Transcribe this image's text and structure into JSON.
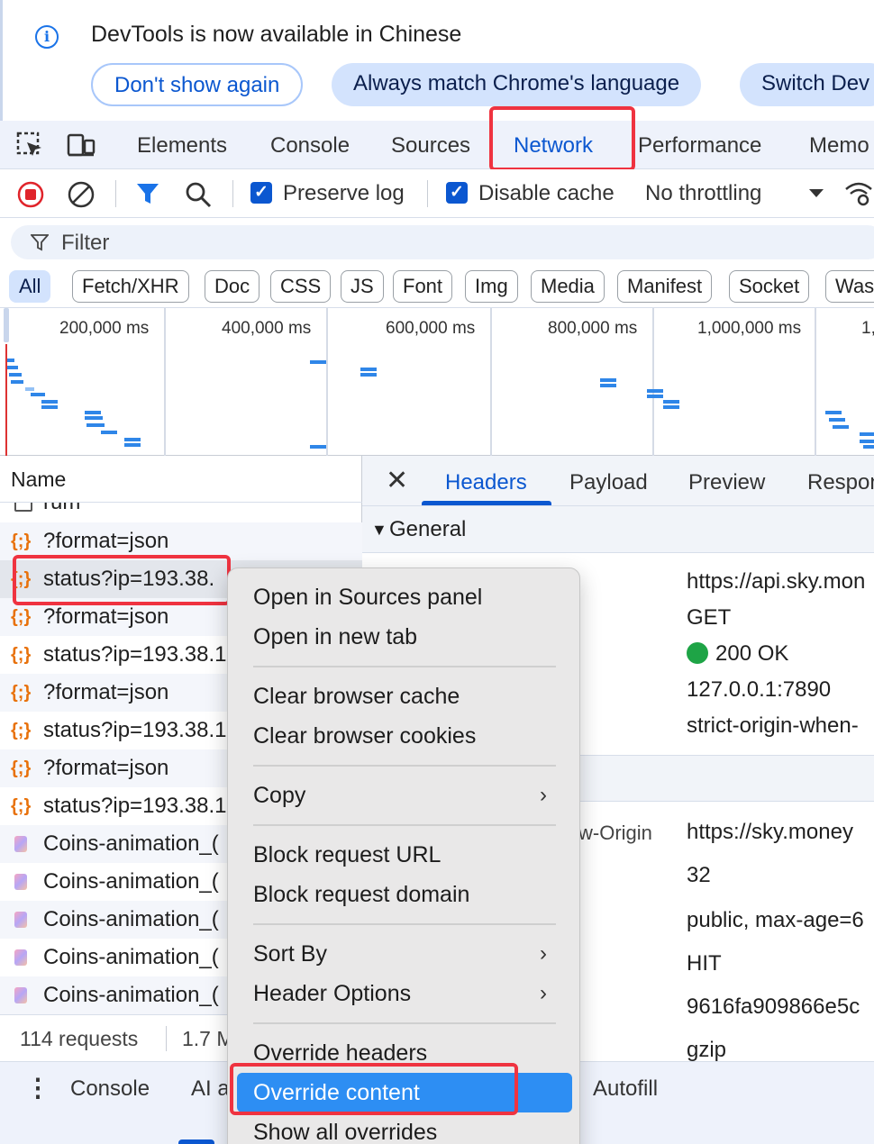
{
  "infobar": {
    "icon": "info-icon",
    "message": "DevTools is now available in Chinese",
    "buttons": [
      "Don't show again",
      "Always match Chrome's language",
      "Switch Dev"
    ]
  },
  "tabs": {
    "items": [
      "Elements",
      "Console",
      "Sources",
      "Network",
      "Performance",
      "Memo"
    ],
    "active": "Network"
  },
  "toolbar": {
    "preserve_log": "Preserve log",
    "preserve_log_checked": true,
    "disable_cache": "Disable cache",
    "disable_cache_checked": true,
    "throttling": "No throttling"
  },
  "filter": {
    "placeholder": "Filter"
  },
  "type_filters": [
    "All",
    "Fetch/XHR",
    "Doc",
    "CSS",
    "JS",
    "Font",
    "Img",
    "Media",
    "Manifest",
    "Socket",
    "Was"
  ],
  "overview": {
    "tick_labels": [
      "200,000 ms",
      "400,000 ms",
      "600,000 ms",
      "800,000 ms",
      "1,000,000 ms",
      "1,"
    ]
  },
  "requests": {
    "header": "Name",
    "partial_top": "rum",
    "rows": [
      {
        "name": "?format=json",
        "type": "json"
      },
      {
        "name": "status?ip=193.38.",
        "type": "json"
      },
      {
        "name": "?format=json",
        "type": "json"
      },
      {
        "name": "status?ip=193.38.1",
        "type": "json"
      },
      {
        "name": "?format=json",
        "type": "json"
      },
      {
        "name": "status?ip=193.38.1",
        "type": "json"
      },
      {
        "name": "?format=json",
        "type": "json"
      },
      {
        "name": "status?ip=193.38.1",
        "type": "json"
      },
      {
        "name": "Coins-animation_(",
        "type": "image"
      },
      {
        "name": "Coins-animation_(",
        "type": "image"
      },
      {
        "name": "Coins-animation_(",
        "type": "image"
      },
      {
        "name": "Coins-animation_(",
        "type": "image"
      },
      {
        "name": "Coins-animation_(",
        "type": "image"
      }
    ],
    "count": "114 requests",
    "size": "1.7 M"
  },
  "details": {
    "tabs": [
      "Headers",
      "Payload",
      "Preview",
      "Respon"
    ],
    "active_tab": "Headers",
    "section": "General",
    "general_values": [
      "https://api.sky.mon",
      "GET",
      "200 OK",
      "127.0.0.1:7890",
      "strict-origin-when-"
    ],
    "response_key": "w-Origin",
    "response_values": [
      "https://sky.money",
      "32",
      "public, max-age=6",
      "HIT",
      "9616fa909866e5c",
      "gzip"
    ]
  },
  "drawer": {
    "tabs": [
      "Console",
      "AI a",
      "Autofill"
    ]
  },
  "context_menu": {
    "open_sources": "Open in Sources panel",
    "open_tab": "Open in new tab",
    "clear_cache": "Clear browser cache",
    "clear_cookies": "Clear browser cookies",
    "copy": "Copy",
    "block_url": "Block request URL",
    "block_domain": "Block request domain",
    "sort_by": "Sort By",
    "header_options": "Header Options",
    "override_headers": "Override headers",
    "override_content": "Override content",
    "show_overrides": "Show all overrides",
    "highlighted": "Override content"
  },
  "colors": {
    "accent": "#0b57d0",
    "highlight": "#ef3340",
    "menu_highlight": "#2d8ef3",
    "status_ok": "#1ea446"
  }
}
